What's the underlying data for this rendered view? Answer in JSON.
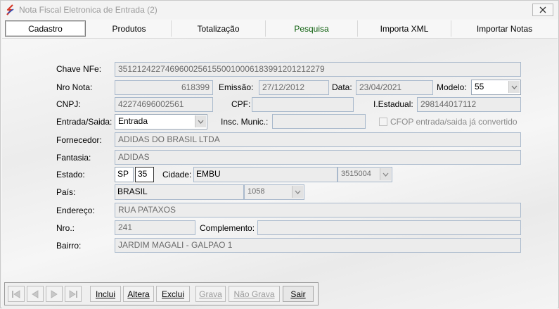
{
  "window": {
    "title": "Nota Fiscal Eletronica de Entrada (2)"
  },
  "tabs": [
    {
      "label": "Cadastro"
    },
    {
      "label": "Produtos"
    },
    {
      "label": "Totalização"
    },
    {
      "label": "Pesquisa"
    },
    {
      "label": "Importa XML"
    },
    {
      "label": "Importar Notas"
    }
  ],
  "form": {
    "chave_label": "Chave NFe:",
    "chave_value": "35121242274696002561550010006183991201212279",
    "nro_nota_label": "Nro Nota:",
    "nro_nota_value": "618399",
    "emissao_label": "Emissão:",
    "emissao_value": "27/12/2012",
    "data_label": "Data:",
    "data_value": "23/04/2021",
    "modelo_label": "Modelo:",
    "modelo_value": "55",
    "cnpj_label": "CNPJ:",
    "cnpj_value": "42274696002561",
    "cpf_label": "CPF:",
    "cpf_value": "",
    "iestadual_label": "I.Estadual:",
    "iestadual_value": "298144017112",
    "entrada_saida_label": "Entrada/Saida:",
    "entrada_saida_value": "Entrada",
    "insc_munic_label": "Insc. Munic.:",
    "insc_munic_value": "",
    "cfop_label": "CFOP entrada/saida já convertido",
    "fornecedor_label": "Fornecedor:",
    "fornecedor_value": "ADIDAS DO BRASIL LTDA",
    "fantasia_label": "Fantasia:",
    "fantasia_value": "ADIDAS",
    "estado_label": "Estado:",
    "estado_uf": "SP",
    "estado_code": "35",
    "cidade_label": "Cidade:",
    "cidade_value": "EMBU",
    "cidade_code": "3515004",
    "pais_label": "País:",
    "pais_value": "BRASIL",
    "pais_code": "1058",
    "endereco_label": "Endereço:",
    "endereco_value": "RUA PATAXOS",
    "nro_label": "Nro.:",
    "nro_value": "241",
    "complemento_label": "Complemento:",
    "complemento_value": "",
    "bairro_label": "Bairro:",
    "bairro_value": "JARDIM MAGALI - GALPAO 1"
  },
  "toolbar": {
    "inclui": "Inclui",
    "altera": "Altera",
    "exclui": "Exclui",
    "grava": "Grava",
    "nao_grava": "Não Grava",
    "sair": "Sair"
  },
  "icons": {
    "first": "first-record-icon",
    "prev": "prev-record-icon",
    "next": "next-record-icon",
    "last": "last-record-icon"
  }
}
